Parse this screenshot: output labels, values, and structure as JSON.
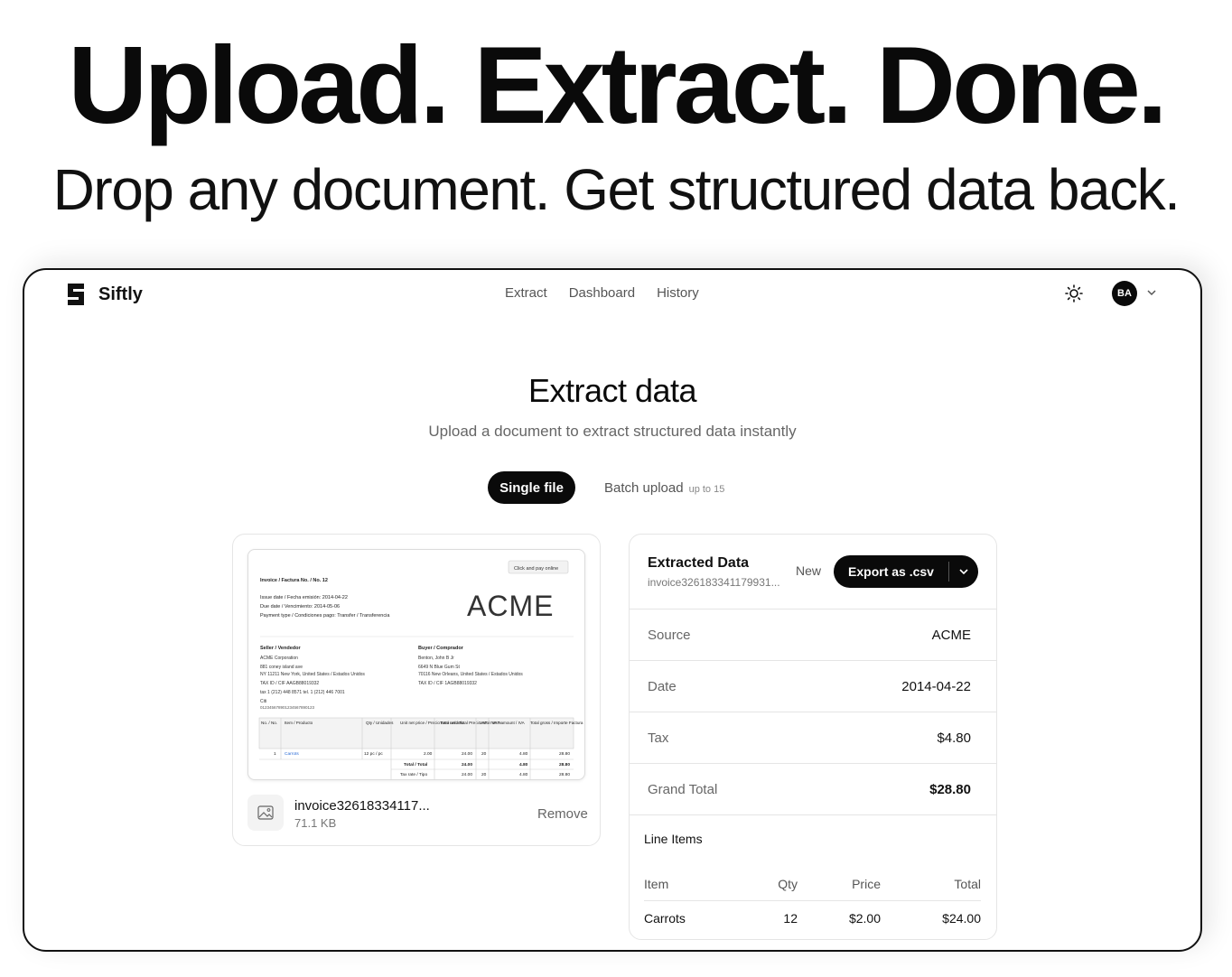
{
  "hero": {
    "title": "Upload. Extract. Done.",
    "subtitle": "Drop any document.  Get structured data back."
  },
  "nav": {
    "brand": "Siftly",
    "links": [
      "Extract",
      "Dashboard",
      "History"
    ],
    "avatar_initials": "BA"
  },
  "page": {
    "title": "Extract data",
    "subtitle": "Upload a document to extract structured data instantly"
  },
  "modes": {
    "single_label": "Single file",
    "batch_label": "Batch upload",
    "batch_note": "up to 15"
  },
  "upload": {
    "file_name": "invoice32618334117...",
    "file_size": "71.1 KB",
    "remove_label": "Remove"
  },
  "invoice_preview": {
    "pay_online": "Click and pay online",
    "invoice_no": "Invoice / Factura No. / No. 12",
    "issue_date": "Issue date / Fecha emisión: 2014-04-22",
    "due_date": "Due date / Vencimiento: 2014-05-06",
    "payment_type": "Payment type / Condiciones pago: Transfer / Transferencia",
    "logo": "ACME",
    "seller_heading": "Seller / Vendedor",
    "seller_lines": [
      "ACME Corporation",
      "881 coney island ave",
      "NY 11211 New York, United States / Estados Unidos",
      "TAX ID / CIF AAGB88019332",
      "tax 1 (212) 448 8571 tel. 1 (212) 446 7001",
      "Citi",
      "012345678901234567890123"
    ],
    "buyer_heading": "Buyer / Comprador",
    "buyer_lines": [
      "Benton, John B Jr",
      "6649 N Blue Gum St",
      "70116 New Orleans, United States / Estados Unidos",
      "TAX ID / CIF 1AGB88019332"
    ],
    "table_headers": [
      "No. / No.",
      "Item / Producto",
      "Qty / Unidades",
      "Unit net price / Precio neto unitario",
      "Total net / Total Precio neto",
      "VAT / IVA %",
      "VAT amount / IVA",
      "Total gross / Importe Factura"
    ],
    "table_row": [
      "1",
      "Carrots",
      "12 pc / pc",
      "2.00",
      "24.00",
      "20",
      "4.80",
      "28.80"
    ],
    "total_label": "Total / Total",
    "total_values": [
      "24.00",
      "4.80",
      "28.80"
    ],
    "tax_rate_label": "Tax rate / Tipo",
    "tax_rate_values": [
      "24.00",
      "20",
      "4.80",
      "28.80"
    ]
  },
  "extracted": {
    "title": "Extracted Data",
    "file_name": "invoice326183341179931...",
    "new_label": "New",
    "export_label": "Export as .csv",
    "fields": [
      {
        "label": "Source",
        "value": "ACME"
      },
      {
        "label": "Date",
        "value": "2014-04-22"
      },
      {
        "label": "Tax",
        "value": "$4.80"
      },
      {
        "label": "Grand Total",
        "value": "$28.80"
      }
    ],
    "line_items_title": "Line Items",
    "line_items_headers": [
      "Item",
      "Qty",
      "Price",
      "Total"
    ],
    "line_items": [
      {
        "item": "Carrots",
        "qty": "12",
        "price": "$2.00",
        "total": "$24.00"
      }
    ]
  }
}
